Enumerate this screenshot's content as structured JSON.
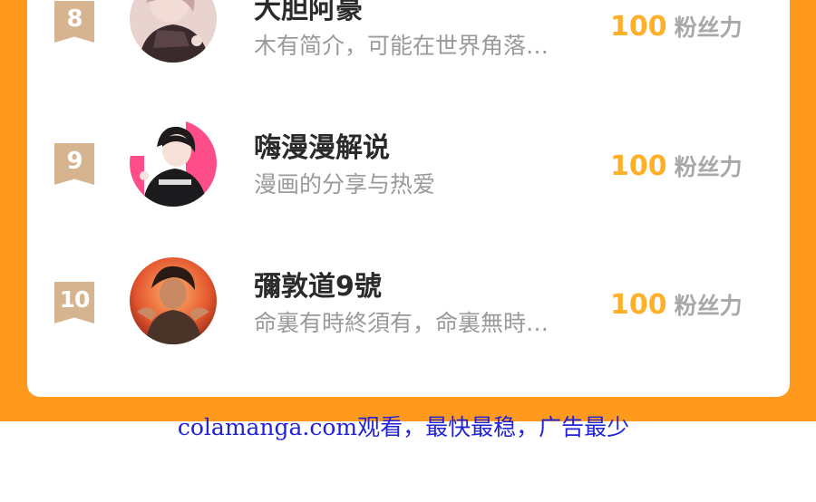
{
  "ranking": {
    "items": [
      {
        "rank": "8",
        "name": "大胆阿豪",
        "description": "木有简介，可能在世界角落…",
        "power_value": "100",
        "power_unit": "粉丝力",
        "avatar_icon": "avatar-anime-boy-icon"
      },
      {
        "rank": "9",
        "name": "嗨漫漫解说",
        "description": "漫画的分享与热爱",
        "power_value": "100",
        "power_unit": "粉丝力",
        "avatar_icon": "avatar-anime-girl-icon"
      },
      {
        "rank": "10",
        "name": "彌敦道9號",
        "description": "命裏有時終須有，命裏無時…",
        "power_value": "100",
        "power_unit": "粉丝力",
        "avatar_icon": "avatar-photo-man-icon"
      }
    ]
  },
  "footer": {
    "link_text": "colamanga.com观看，最快最稳，广告最少"
  },
  "colors": {
    "frame_orange": "#ff9a1f",
    "badge_tan": "#d6b48f",
    "power_gold": "#ffb028",
    "link_blue": "#2323d6"
  }
}
